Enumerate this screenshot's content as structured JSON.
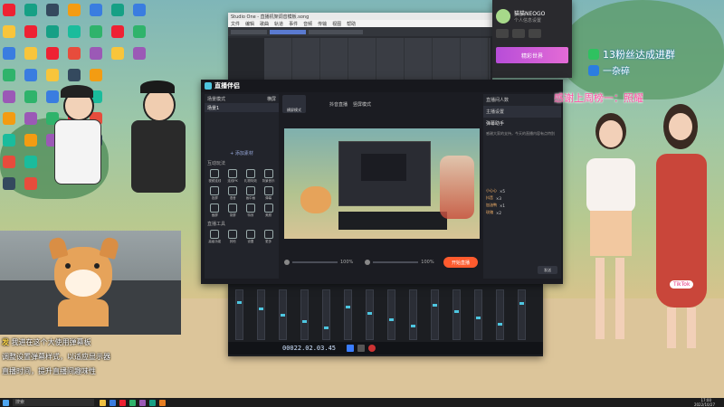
{
  "desktop": {
    "taskbar": {
      "search_placeholder": "搜索",
      "time": "17:00",
      "date": "2022/10/27"
    }
  },
  "stream_overlay": {
    "top_right_text": "13粉丝达成进群",
    "top_right_text2": "一杂碎",
    "thanks_banner": "感谢上周榜一：照耀",
    "chat_lines": [
      {
        "user": "发",
        "text": "我进在这个大使用弹幕板"
      },
      {
        "user": "",
        "text": "调整设置弹幕样式，以适应显示器"
      },
      {
        "user": "",
        "text": "直播时间，提升直播间趣味性"
      }
    ],
    "corner_tag": "TikTok"
  },
  "studio_one": {
    "title": "Studio One - 直播机架调音模板.song",
    "menu": [
      "文件",
      "编辑",
      "歌曲",
      "轨道",
      "事件",
      "音频",
      "传输",
      "视图",
      "帮助"
    ],
    "transport_time": "00022.02.03.45"
  },
  "profile_popup": {
    "user_name": "猫猫NEOGO",
    "sub": "个人信息设置",
    "banner": "精彩世界"
  },
  "live_app": {
    "logo": "直播伴侣",
    "header_left_label": "场景模式",
    "header_right_label": "横屏",
    "scene_name": "场景1",
    "add_scene": "+ 添加素材",
    "section_tools": "互动玩法",
    "section_more": "直播工具",
    "tools": [
      "视频连线",
      "连线PK",
      "礼物特效",
      "背景音乐",
      "投屏",
      "语音",
      "画中画",
      "弹幕",
      "截屏",
      "录屏",
      "特效",
      "美颜"
    ],
    "bottom_tools": [
      "高级功能",
      "其他",
      "设置",
      "更多"
    ],
    "top_tab1": "横屏模式",
    "top_tab2": "竖屏模式",
    "start_btn": "开始直播",
    "preview_title": "抖音直播",
    "volume1": "100%",
    "volume2": "100%",
    "right_panel_title": "直播间人数",
    "right_tab": "主播设置",
    "right_section": "弹幕助手",
    "notice": "感谢大家的支持，今天的直播内容有点特别",
    "gifts": [
      {
        "name": "小心心",
        "count": "×5"
      },
      {
        "name": "抖音",
        "count": "×3"
      },
      {
        "name": "加油鸭",
        "count": "×1"
      },
      {
        "name": "玫瑰",
        "count": "×2"
      }
    ],
    "send_btn": "发送"
  },
  "colors": {
    "accent_orange": "#ff5b2e",
    "accent_cyan": "#4ec6e0",
    "panel_dark": "#1e1f24"
  }
}
